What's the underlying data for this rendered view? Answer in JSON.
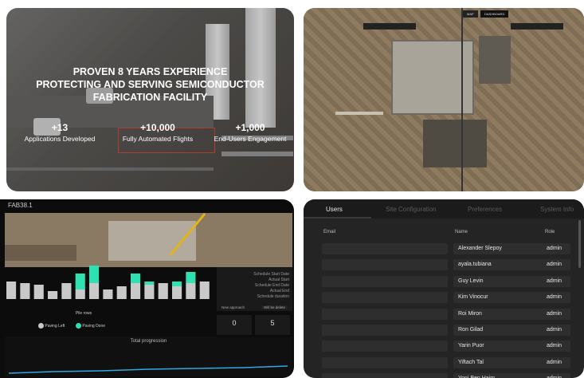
{
  "panel1": {
    "headline_lines": [
      "PROVEN 8 YEARS EXPERIENCE",
      "PROTECTING AND SERVING SEMICONDUCTOR",
      "FABRICATION FACILITY"
    ],
    "stats": [
      {
        "value": "+13",
        "label": "Applications Developed"
      },
      {
        "value": "+10,000",
        "label": "Fully Automated Flights"
      },
      {
        "value": "+1,000",
        "label": "End-Users Engagement"
      }
    ]
  },
  "panel2": {
    "tabs": [
      "MAP",
      "DASHBOARD"
    ]
  },
  "panel3": {
    "title": "FAB38.1",
    "legend": {
      "title": "Pile rows",
      "items": [
        "Paving Left",
        "Paving Done"
      ]
    },
    "section_title": "Total progression",
    "right_info": [
      "Schedule Start Date",
      "Actual Start",
      "Schedule End Date",
      "Actual End",
      "Schedule duration",
      "Will be delete"
    ],
    "new_approach_label": "New approach",
    "counters": [
      {
        "value": "0"
      },
      {
        "value": "5"
      }
    ],
    "chart_data": {
      "type": "bar",
      "series": [
        {
          "name": "Paving Left",
          "values": [
            0.55,
            0.5,
            0.45,
            0.25,
            0.5,
            0.3,
            0.5,
            0.3,
            0.4,
            0.5,
            0.45,
            0.5,
            0.4,
            0.5,
            0.55
          ]
        },
        {
          "name": "Paving Done",
          "values": [
            0,
            0,
            0,
            0,
            0,
            0.5,
            0.55,
            0,
            0,
            0.3,
            0.1,
            0,
            0.15,
            0.35,
            0
          ]
        }
      ]
    }
  },
  "panel4": {
    "tabs": [
      "Users",
      "Site Configuration",
      "Preferences",
      "System Info"
    ],
    "columns": [
      "Email",
      "Name",
      "Role"
    ],
    "rows": [
      {
        "name": "Alexander Slepoy",
        "role": "admin"
      },
      {
        "name": "ayala.tubiana",
        "role": "admin"
      },
      {
        "name": "Guy Levin",
        "role": "admin"
      },
      {
        "name": "Kim Vinocur",
        "role": "admin"
      },
      {
        "name": "Roi Miron",
        "role": "admin"
      },
      {
        "name": "Ron Gilad",
        "role": "admin"
      },
      {
        "name": "Yarin Puor",
        "role": "admin"
      },
      {
        "name": "Yiftach Tal",
        "role": "admin"
      },
      {
        "name": "Yoni Ben Haim",
        "role": "admin"
      }
    ]
  },
  "colors": {
    "accent_green": "#2fe0b0",
    "bar_grey": "#c9c9c9",
    "line_blue": "#2fa8e0"
  }
}
